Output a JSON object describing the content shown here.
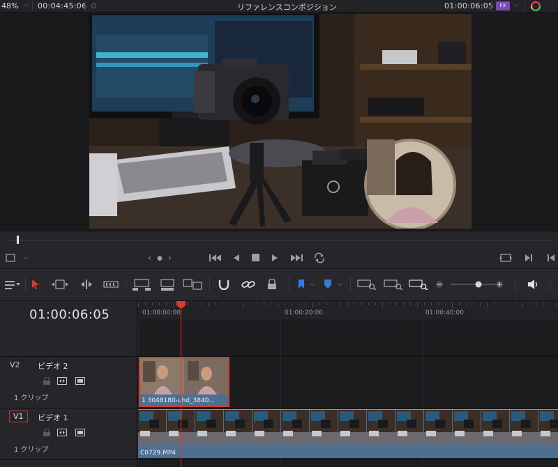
{
  "topbar": {
    "zoom": "48%",
    "source_timecode": "00:04:45:06",
    "title": "リファレンスコンポジション",
    "record_timecode": "01:00:06:05",
    "fx_badge": "FX",
    "caret": "⌵"
  },
  "transport": {
    "nav_left": "‹",
    "nav_right": "›",
    "nav_dot": "●"
  },
  "timeline": {
    "current_timecode": "01:00:06:05",
    "ruler_labels": [
      "01:00:00:00",
      "01:00:20:00",
      "01:00:40:00"
    ],
    "tracks": [
      {
        "id": "V2",
        "name": "ビデオ 2",
        "count": "1 クリップ"
      },
      {
        "id": "V1",
        "name": "ビデオ 1",
        "count": "1 クリップ"
      }
    ],
    "clips": {
      "v2_label": "1 3048180-uhd_3840...",
      "v1_label": "C0729.MP4"
    }
  },
  "icons": {
    "selection": "selection-arrow-icon",
    "blade": "blade-icon",
    "snap": "snap-magnet-icon",
    "link": "link-icon",
    "lock": "lock-icon",
    "flag": "flag-icon",
    "marker": "marker-icon",
    "zoom": "zoom-icon",
    "volume": "speaker-icon"
  },
  "colors": {
    "playhead": "#e2372f",
    "clip": "#4d6f92",
    "selected_border": "#d23b32"
  }
}
